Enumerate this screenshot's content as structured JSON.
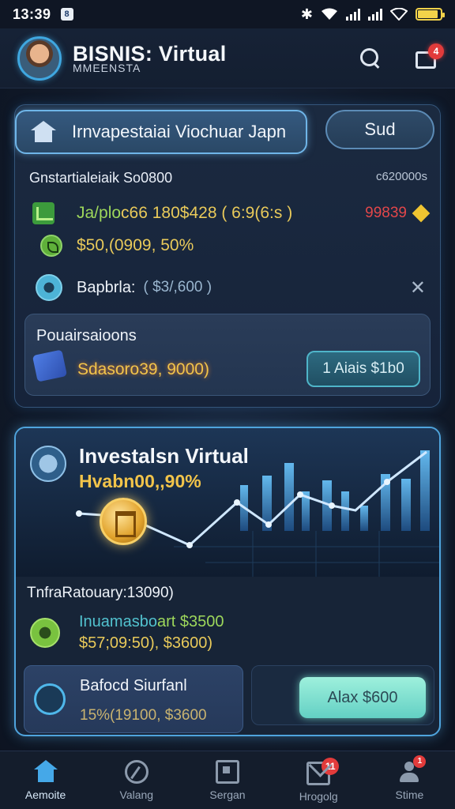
{
  "status_bar": {
    "time": "13:39",
    "app_indicator": "8",
    "icons": [
      "bluetooth-icon",
      "wifi-icon",
      "signal-icon",
      "signal-icon",
      "wifi-icon",
      "battery-icon"
    ],
    "battery_level": 0.9,
    "battery_color": "#f3d34a"
  },
  "header": {
    "title": "BISNIS: Virtual",
    "subtitle": "MMEENSTA",
    "notification_count": "4"
  },
  "top_card": {
    "tab_primary": "Irnvapestaiai Viochuar Japn",
    "tab_secondary": "Sud",
    "summary_label": "Gnstartialeiaik So0800",
    "summary_value": "c620000s",
    "stat_prefix": "Ja/plo",
    "stat_main": "c66 180$428 ( 6:9(6:s )",
    "stat_right": "99839",
    "percent_text": "$50,(0909, 50%",
    "badge_label": "Bapbrla:",
    "badge_value": "( $3/,600 )",
    "panel_title": "Pouairsaioons",
    "panel_amount": "Sdasoro39, 9000)",
    "panel_cta": "1 Aiais $1b0"
  },
  "investment_card": {
    "title": "Investalsn Virtual",
    "subtitle": "Hvabn00,,90%",
    "line1": "TnfraRatouary:13090)",
    "row_title_a": "Inuamasbo",
    "row_title_b": "art $3500",
    "row_value": "$57;09:50), $3600)",
    "sub_name": "Bafocd Siurfanl",
    "sub_value": "15%(19100, $3600",
    "cta": "Alax $600"
  },
  "bottom_nav": [
    {
      "label": "Aemoite",
      "icon": "home-icon",
      "active": true
    },
    {
      "label": "Valang",
      "icon": "wallet-icon"
    },
    {
      "label": "Sergan",
      "icon": "document-icon"
    },
    {
      "label": "Hrogolg",
      "icon": "mail-icon",
      "badge": "11"
    },
    {
      "label": "Stime",
      "icon": "user-icon",
      "badge": "1"
    }
  ],
  "colors": {
    "accent": "#45a8e8",
    "gold": "#e9ca5a",
    "green": "#9dd75b",
    "alert_red": "#e23b3b",
    "cta_mint": "#9ef0dc"
  }
}
